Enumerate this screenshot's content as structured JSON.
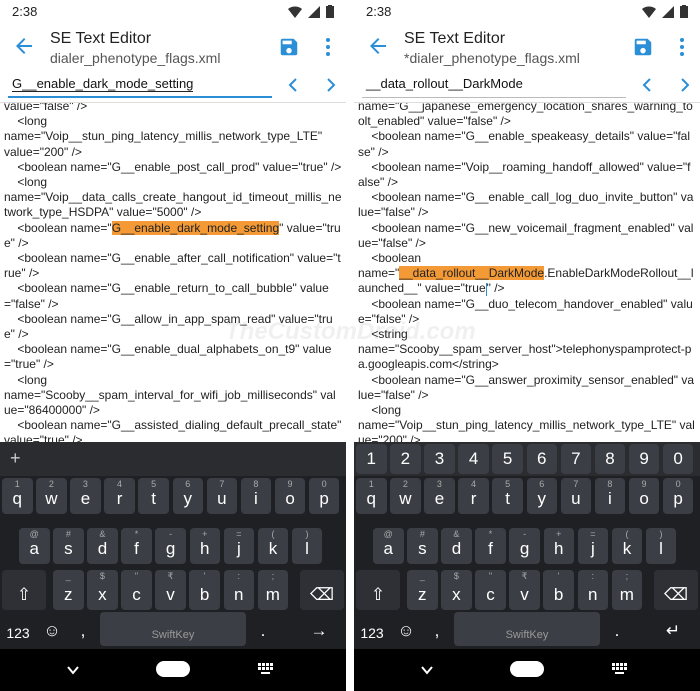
{
  "left": {
    "status": {
      "time": "2:38"
    },
    "appbar": {
      "title": "SE Text Editor",
      "file": "dialer_phenotype_flags.xml"
    },
    "search": {
      "value": "G__enable_dark_mode_setting"
    },
    "editor": {
      "l1": "value=\"false\" />",
      "l2": "    <long",
      "l3": "name=\"Voip__stun_ping_latency_millis_network_type_LTE\"",
      "l4": "value=\"200\" />",
      "l5": "    <boolean name=\"G__enable_post_call_prod\" value=\"true\" />",
      "l6": "    <long",
      "l7": "name=\"Voip__data_calls_create_hangout_id_timeout_millis_network_type_HSDPA\" value=\"5000\" />",
      "l8a": "    <boolean name=\"",
      "l8hl": "G__enable_dark_mode_setting",
      "l8b": "\" value=\"true\" />",
      "l9": "    <boolean name=\"G__enable_after_call_notification\" value=\"true\" />",
      "l10": "    <boolean name=\"G__enable_return_to_call_bubble\" value=\"false\" />",
      "l11": "    <boolean name=\"G__allow_in_app_spam_read\" value=\"true\" />",
      "l12": "    <boolean name=\"G__enable_dual_alphabets_on_t9\" value=\"true\" />",
      "l13": "    <long",
      "l14": "name=\"Scooby__spam_interval_for_wifi_job_milliseconds\" value=\"86400000\" />",
      "l15": "    <boolean name=\"G__assisted_dialing_default_precall_state\" value=\"true\" />"
    },
    "keyboard": {
      "toolbar_plus": "+"
    }
  },
  "right": {
    "status": {
      "time": "2:38"
    },
    "appbar": {
      "title": "SE Text Editor",
      "file": "*dialer_phenotype_flags.xml"
    },
    "search": {
      "value": "__data_rollout__DarkMode"
    },
    "editor": {
      "l1": "name=\"G__japanese_emergency_location_shares_warning_toolt_enabled\" value=\"false\" />",
      "l2": "    <boolean name=\"G__enable_speakeasy_details\" value=\"false\" />",
      "l3": "    <boolean name=\"Voip__roaming_handoff_allowed\" value=\"false\" />",
      "l4": "    <boolean name=\"G__enable_call_log_duo_invite_button\" value=\"false\" />",
      "l5": "    <boolean name=\"G__new_voicemail_fragment_enabled\" value=\"false\" />",
      "l6": "    <boolean",
      "l7a": "name=\"",
      "l7hl": "__data_rollout__DarkMode",
      "l7b": ".EnableDarkModeRollout__launched__\" value=\"true",
      "l7c": "\" />",
      "l8": "    <boolean name=\"G__duo_telecom_handover_enabled\" value=\"false\" />",
      "l9": "    <string",
      "l10": "name=\"Scooby__spam_server_host\">telephonyspamprotect-pa.googleapis.com</string>",
      "l11": "    <boolean name=\"G__answer_proximity_sensor_enabled\" value=\"false\" />",
      "l12": "    <long",
      "l13": "name=\"Voip__stun_ping_latency_millis_network_type_LTE\" value=\"200\" />"
    },
    "numbers": [
      "1",
      "2",
      "3",
      "4",
      "5",
      "6",
      "7",
      "8",
      "9",
      "0"
    ]
  },
  "keys": {
    "row1": [
      [
        "1",
        "q"
      ],
      [
        "2",
        "w"
      ],
      [
        "3",
        "e"
      ],
      [
        "4",
        "r"
      ],
      [
        "5",
        "t"
      ],
      [
        "6",
        "y"
      ],
      [
        "7",
        "u"
      ],
      [
        "8",
        "i"
      ],
      [
        "9",
        "o"
      ],
      [
        "0",
        "p"
      ]
    ],
    "row2": [
      [
        "@",
        "a"
      ],
      [
        "#",
        "s"
      ],
      [
        "&",
        "d"
      ],
      [
        "*",
        "f"
      ],
      [
        "-",
        "g"
      ],
      [
        "+",
        "h"
      ],
      [
        "=",
        "j"
      ],
      [
        "(",
        "k"
      ],
      [
        ")",
        "l"
      ]
    ],
    "row3": [
      [
        "_",
        "z"
      ],
      [
        "$",
        "x"
      ],
      [
        "\"",
        "c"
      ],
      [
        "₹",
        "v"
      ],
      [
        "'",
        "b"
      ],
      [
        ":",
        "n"
      ],
      [
        ";",
        "m"
      ]
    ],
    "row3_hints": [
      "_",
      "$",
      "\"",
      "₹",
      "'",
      ":",
      ";"
    ],
    "num_label": "123",
    "space_label": "SwiftKey",
    "period": ".",
    "comma": ","
  },
  "watermark": "TheCustomDroid.com"
}
